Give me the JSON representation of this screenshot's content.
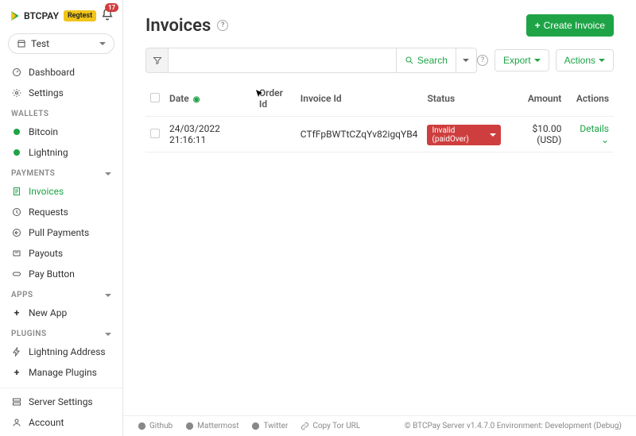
{
  "brand": {
    "name": "BTCPAY",
    "env_badge": "Regtest",
    "notification_count": "17"
  },
  "store_selector": {
    "name": "Test"
  },
  "nav": {
    "dashboard": "Dashboard",
    "settings": "Settings",
    "wallets_section": "WALLETS",
    "bitcoin": "Bitcoin",
    "lightning": "Lightning",
    "payments_section": "PAYMENTS",
    "invoices": "Invoices",
    "requests": "Requests",
    "pull_payments": "Pull Payments",
    "payouts": "Payouts",
    "pay_button": "Pay Button",
    "apps_section": "APPS",
    "new_app": "New App",
    "plugins_section": "PLUGINS",
    "lightning_address": "Lightning Address",
    "manage_plugins": "Manage Plugins",
    "server_settings": "Server Settings",
    "account": "Account"
  },
  "page": {
    "title": "Invoices",
    "create_button": "Create Invoice",
    "search_label": "Search",
    "export_label": "Export",
    "actions_label": "Actions"
  },
  "columns": {
    "date": "Date",
    "order_id": "Order Id",
    "invoice_id": "Invoice Id",
    "status": "Status",
    "amount": "Amount",
    "actions": "Actions"
  },
  "rows": [
    {
      "date": "24/03/2022 21:16:11",
      "order_id": "",
      "invoice_id": "CTfFpBWTtCZqYv82igqYB4",
      "status": "Invalid (paidOver)",
      "amount": "$10.00 (USD)",
      "action": "Details"
    }
  ],
  "footer": {
    "github": "Github",
    "mattermost": "Mattermost",
    "twitter": "Twitter",
    "copy_tor": "Copy Tor URL",
    "copyright": "© BTCPay Server v1.4.7.0 Environment: Development (Debug)"
  }
}
